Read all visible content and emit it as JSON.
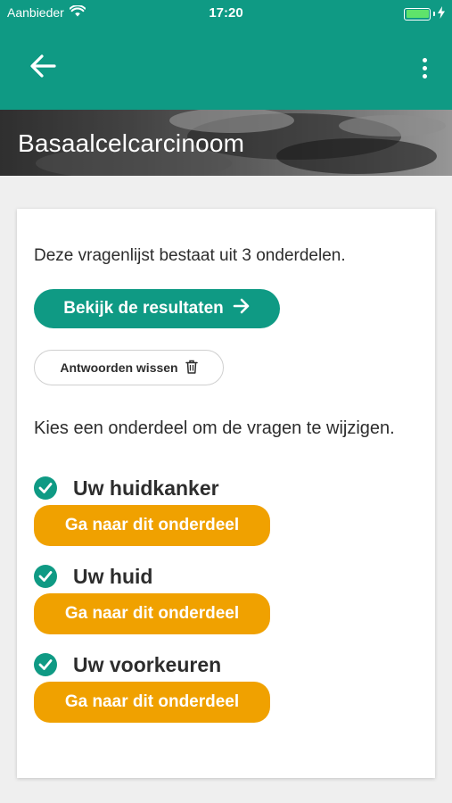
{
  "status": {
    "carrier": "Aanbieder",
    "time": "17:20",
    "battery_level": 1.0
  },
  "appbar": {
    "back_icon": "arrow-left-icon",
    "menu_icon": "more-vertical-icon"
  },
  "banner": {
    "title": "Basaalcelcarcinoom"
  },
  "card": {
    "intro": "Deze vragenlijst bestaat uit 3 onderdelen.",
    "results_label": "Bekijk de resultaten",
    "clear_label": "Antwoorden wissen",
    "choose_text": "Kies een onderdeel om de vragen te wijzigen.",
    "sections": [
      {
        "title": "Uw huidkanker",
        "button": "Ga naar dit onderdeel"
      },
      {
        "title": "Uw huid",
        "button": "Ga naar dit onderdeel"
      },
      {
        "title": "Uw voorkeuren",
        "button": "Ga naar dit onderdeel"
      }
    ]
  },
  "colors": {
    "primary": "#0f9a84",
    "accent": "#f0a100",
    "background": "#efefef"
  }
}
